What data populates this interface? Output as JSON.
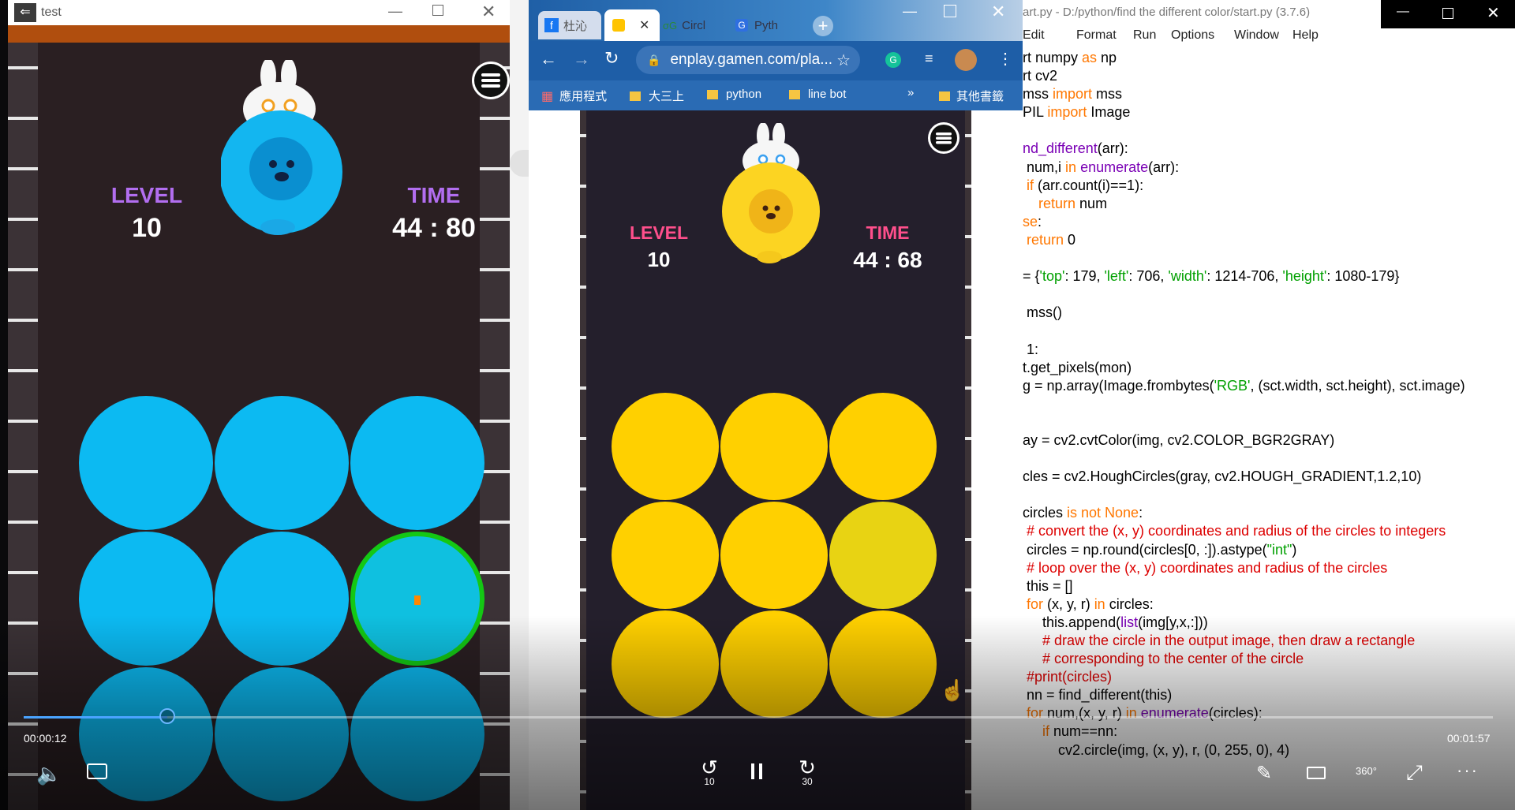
{
  "left_window": {
    "title": "test",
    "game": {
      "level_label": "LEVEL",
      "level_value": "10",
      "time_label": "TIME",
      "time_value": "44 : 80",
      "circle_color": "#0cbaf2",
      "highlight_color": "#14c814",
      "marker_color": "#ff8800"
    }
  },
  "middle_window": {
    "tabs": [
      {
        "label": "杜沁"
      },
      {
        "label": ""
      },
      {
        "label": "Circl"
      },
      {
        "label": "Pyth"
      }
    ],
    "address": "enplay.gamen.com/pla...",
    "bookmarks": [
      {
        "label": "應用程式"
      },
      {
        "label": "大三上"
      },
      {
        "label": "python"
      },
      {
        "label": "line bot"
      },
      {
        "label": "»"
      },
      {
        "label": "其他書籤"
      }
    ],
    "game": {
      "level_label": "LEVEL",
      "level_value": "10",
      "time_label": "TIME",
      "time_value": "44 : 68",
      "circle_color": "#ffd000",
      "odd_circle_color": "#e8d313"
    }
  },
  "right_window": {
    "title": "art.py - D:/python/find the different color/start.py (3.7.6)",
    "menu": [
      "Edit",
      "Format",
      "Run",
      "Options",
      "Window",
      "Help"
    ],
    "code": [
      [
        {
          "t": "rt numpy ",
          "c": ""
        },
        {
          "t": "as",
          "c": "kw"
        },
        {
          "t": " np",
          "c": ""
        }
      ],
      [
        {
          "t": "rt cv2",
          "c": ""
        }
      ],
      [
        {
          "t": "mss ",
          "c": ""
        },
        {
          "t": "import",
          "c": "kw"
        },
        {
          "t": " mss",
          "c": ""
        }
      ],
      [
        {
          "t": "PIL ",
          "c": ""
        },
        {
          "t": "import",
          "c": "kw"
        },
        {
          "t": " Image",
          "c": ""
        }
      ],
      [
        {
          "t": "",
          "c": ""
        }
      ],
      [
        {
          "t": "nd_different",
          "c": "kw2"
        },
        {
          "t": "(arr):",
          "c": ""
        }
      ],
      [
        {
          "t": " num,i ",
          "c": ""
        },
        {
          "t": "in",
          "c": "kw"
        },
        {
          "t": " ",
          "c": ""
        },
        {
          "t": "enumerate",
          "c": "kw2"
        },
        {
          "t": "(arr):",
          "c": ""
        }
      ],
      [
        {
          "t": " ",
          "c": ""
        },
        {
          "t": "if",
          "c": "kw"
        },
        {
          "t": " (arr.count(i)==1):",
          "c": ""
        }
      ],
      [
        {
          "t": "    ",
          "c": ""
        },
        {
          "t": "return",
          "c": "kw"
        },
        {
          "t": " num",
          "c": ""
        }
      ],
      [
        {
          "t": "se",
          "c": "kw"
        },
        {
          "t": ":",
          "c": ""
        }
      ],
      [
        {
          "t": " ",
          "c": ""
        },
        {
          "t": "return",
          "c": "kw"
        },
        {
          "t": " 0",
          "c": ""
        }
      ],
      [
        {
          "t": "",
          "c": ""
        }
      ],
      [
        {
          "t": "= {",
          "c": ""
        },
        {
          "t": "'top'",
          "c": "str"
        },
        {
          "t": ": 179, ",
          "c": ""
        },
        {
          "t": "'left'",
          "c": "str"
        },
        {
          "t": ": 706, ",
          "c": ""
        },
        {
          "t": "'width'",
          "c": "str"
        },
        {
          "t": ": 1214-706, ",
          "c": ""
        },
        {
          "t": "'height'",
          "c": "str"
        },
        {
          "t": ": 1080-179}",
          "c": ""
        }
      ],
      [
        {
          "t": "",
          "c": ""
        }
      ],
      [
        {
          "t": " mss()",
          "c": ""
        }
      ],
      [
        {
          "t": "",
          "c": ""
        }
      ],
      [
        {
          "t": " 1:",
          "c": ""
        }
      ],
      [
        {
          "t": "t.get_pixels(mon)",
          "c": ""
        }
      ],
      [
        {
          "t": "g = np.array(Image.frombytes(",
          "c": ""
        },
        {
          "t": "'RGB'",
          "c": "str"
        },
        {
          "t": ", (sct.width, sct.height), sct.image)",
          "c": ""
        }
      ],
      [
        {
          "t": "",
          "c": ""
        }
      ],
      [
        {
          "t": "",
          "c": ""
        }
      ],
      [
        {
          "t": "ay = cv2.cvtColor(img, cv2.COLOR_BGR2GRAY)",
          "c": ""
        }
      ],
      [
        {
          "t": "",
          "c": ""
        }
      ],
      [
        {
          "t": "cles = cv2.HoughCircles(gray, cv2.HOUGH_GRADIENT,1.2,10)",
          "c": ""
        }
      ],
      [
        {
          "t": "",
          "c": ""
        }
      ],
      [
        {
          "t": "circles ",
          "c": ""
        },
        {
          "t": "is not None",
          "c": "kw"
        },
        {
          "t": ":",
          "c": ""
        }
      ],
      [
        {
          "t": " # convert the (x, y) coordinates and radius of the circles to integers",
          "c": "cm"
        }
      ],
      [
        {
          "t": " circles = np.round(circles[0, :]).astype(",
          "c": ""
        },
        {
          "t": "\"int\"",
          "c": "str"
        },
        {
          "t": ")",
          "c": ""
        }
      ],
      [
        {
          "t": " # loop over the (x, y) coordinates and radius of the circles",
          "c": "cm"
        }
      ],
      [
        {
          "t": " this = []",
          "c": ""
        }
      ],
      [
        {
          "t": " ",
          "c": ""
        },
        {
          "t": "for",
          "c": "kw"
        },
        {
          "t": " (x, y, r) ",
          "c": ""
        },
        {
          "t": "in",
          "c": "kw"
        },
        {
          "t": " circles:",
          "c": ""
        }
      ],
      [
        {
          "t": "     this.append(",
          "c": ""
        },
        {
          "t": "list",
          "c": "kw2"
        },
        {
          "t": "(img[y,x,:]))",
          "c": ""
        }
      ],
      [
        {
          "t": "     # draw the circle in the output image, then draw a rectangle",
          "c": "cm"
        }
      ],
      [
        {
          "t": "     # corresponding to the center of the circle",
          "c": "cm"
        }
      ],
      [
        {
          "t": " #print(circles)",
          "c": "cm"
        }
      ],
      [
        {
          "t": " nn = find_different(this)",
          "c": ""
        }
      ],
      [
        {
          "t": " ",
          "c": ""
        },
        {
          "t": "for",
          "c": "kw"
        },
        {
          "t": " num,(x, y, r) ",
          "c": ""
        },
        {
          "t": "in",
          "c": "kw"
        },
        {
          "t": " ",
          "c": ""
        },
        {
          "t": "enumerate",
          "c": "kw2"
        },
        {
          "t": "(circles):",
          "c": ""
        }
      ],
      [
        {
          "t": "     ",
          "c": ""
        },
        {
          "t": "if",
          "c": "kw"
        },
        {
          "t": " num==nn:",
          "c": ""
        }
      ],
      [
        {
          "t": "         cv2.circle(img, (x, y), r, (0, 255, 0), 4)",
          "c": ""
        }
      ]
    ]
  },
  "player": {
    "elapsed": "00:00:12",
    "duration": "00:01:57",
    "progress": 0.098,
    "rewind_label": "10",
    "forward_label": "30",
    "vr_label": "360°"
  }
}
